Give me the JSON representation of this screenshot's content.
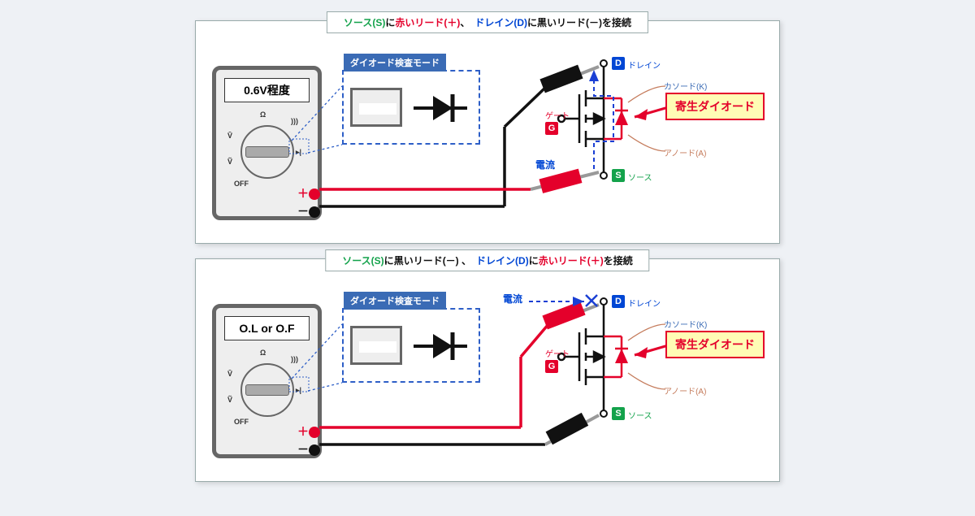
{
  "title1": {
    "parts": [
      {
        "cls": "g",
        "t": "ソース(S)"
      },
      {
        "cls": "k",
        "t": "に"
      },
      {
        "cls": "r",
        "t": "赤いリード(＋)"
      },
      {
        "cls": "k",
        "t": "、　"
      },
      {
        "cls": "b",
        "t": "ドレイン(D)"
      },
      {
        "cls": "k",
        "t": "に"
      },
      {
        "cls": "k",
        "t": "黒いリード(－)"
      },
      {
        "cls": "k",
        "t": "を接続"
      }
    ]
  },
  "title2": {
    "parts": [
      {
        "cls": "g",
        "t": "ソース(S)"
      },
      {
        "cls": "k",
        "t": "に"
      },
      {
        "cls": "k",
        "t": "黒いリード(－)"
      },
      {
        "cls": "k",
        "t": " 、　"
      },
      {
        "cls": "b",
        "t": "ドレイン(D)"
      },
      {
        "cls": "k",
        "t": "に"
      },
      {
        "cls": "r",
        "t": "赤いリード(＋)"
      },
      {
        "cls": "k",
        "t": "を接続"
      }
    ]
  },
  "meter1_lcd": "0.6V程度",
  "meter2_lcd": "O.L or O.F",
  "inset_title": "ダイオード検査モード",
  "callout": "寄生ダイオード",
  "labels": {
    "drain": "ドレイン",
    "source": "ソース",
    "gate": "ゲート",
    "cathode": "カソード(K)",
    "anode": "アノード(A)",
    "current": "電流",
    "D": "D",
    "G": "G",
    "S": "S"
  },
  "dial": {
    "ohm": "Ω",
    "sound": ")))",
    "vbar": "V̄",
    "vtilde": "Ṽ",
    "off": "OFF"
  },
  "plus": "＋",
  "minus": "－"
}
